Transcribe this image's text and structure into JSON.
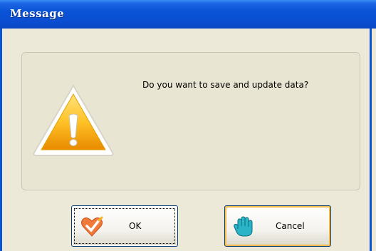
{
  "window": {
    "title": "Message"
  },
  "message": "Do you want to save and update data?",
  "buttons": {
    "ok_label": "OK",
    "cancel_label": "Cancel"
  },
  "icons": {
    "main": "warning-icon",
    "ok": "heart-check-icon",
    "cancel": "hand-stop-icon"
  },
  "colors": {
    "titlebar": "#0A53D6",
    "dialog_bg": "#ECE9D8",
    "focus_ring": "#F8B94B"
  }
}
